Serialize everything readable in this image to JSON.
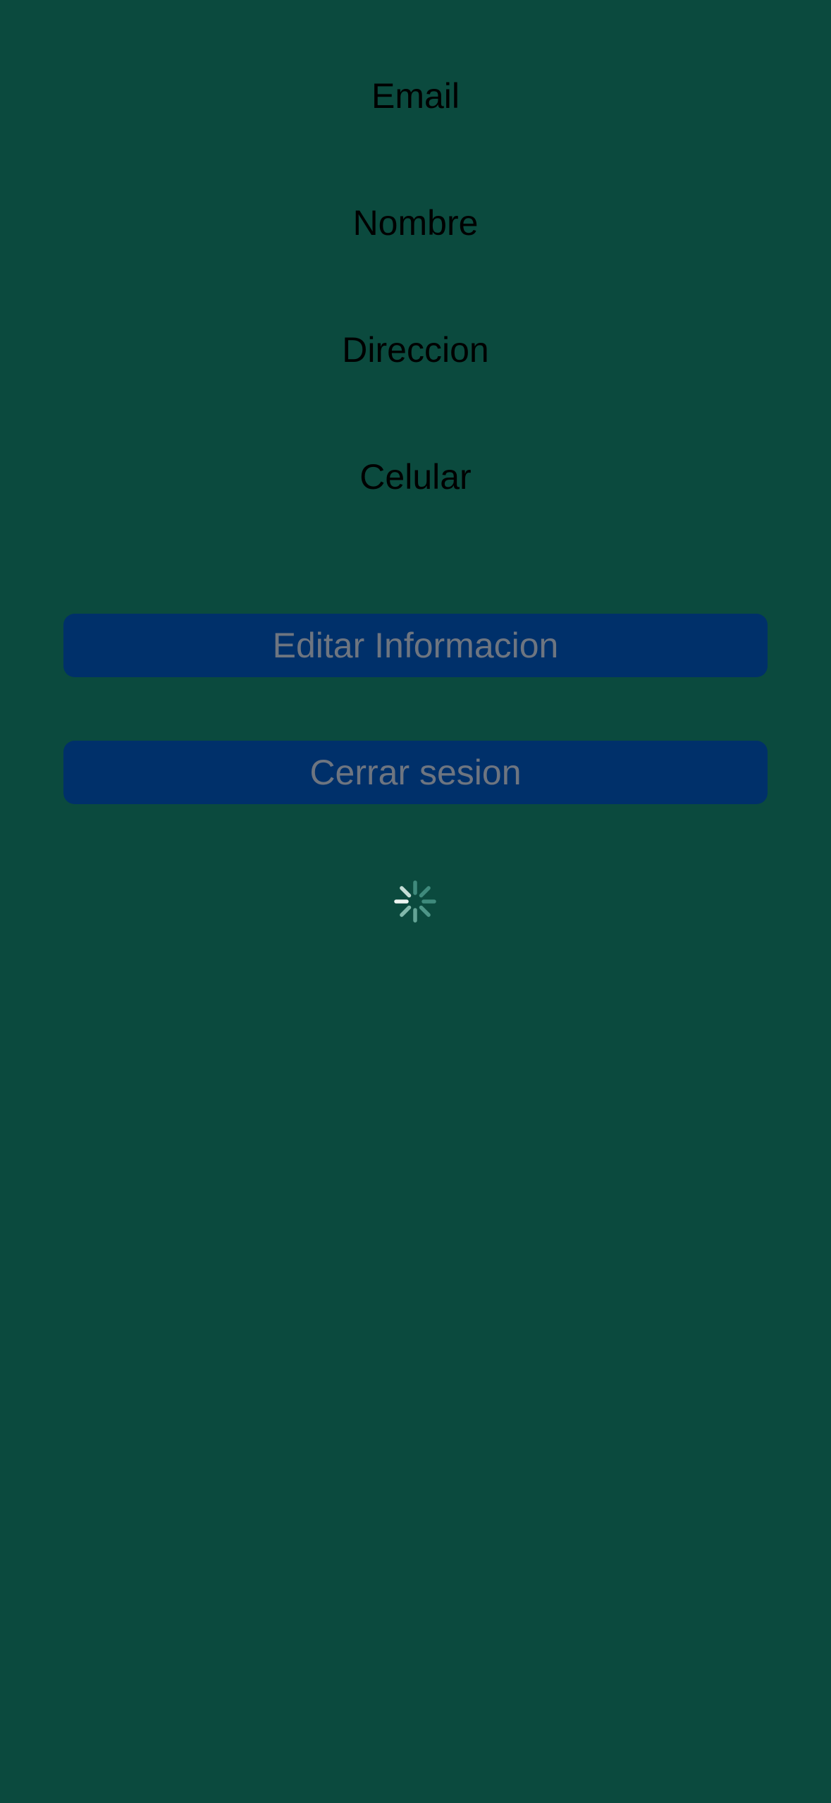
{
  "profile": {
    "email_label": "Email",
    "name_label": "Nombre",
    "address_label": "Direccion",
    "phone_label": "Celular"
  },
  "actions": {
    "edit_label": "Editar Informacion",
    "logout_label": "Cerrar sesion"
  },
  "colors": {
    "background": "#0b4a3e",
    "button_background": "#00306a",
    "button_text": "#6e7580",
    "label_text": "#000000"
  },
  "loading_indicator": {
    "icon": "activity-spinner-icon",
    "visible": true
  }
}
